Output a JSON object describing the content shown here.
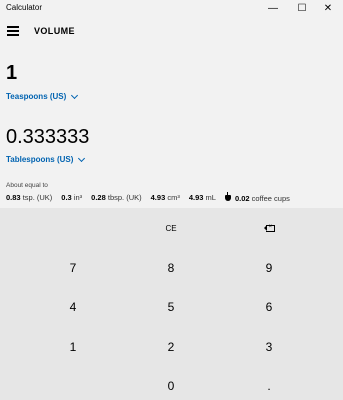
{
  "window": {
    "title": "Calculator",
    "minimize": "—",
    "maximize": "☐",
    "close": "✕"
  },
  "header": {
    "mode": "VOLUME"
  },
  "from": {
    "value": "1",
    "unit": "Teaspoons (US)"
  },
  "to": {
    "value": "0.333333",
    "unit": "Tablespoons (US)"
  },
  "about": {
    "label": "About equal to",
    "items": [
      {
        "value": "0.83",
        "unit": "tsp. (UK)"
      },
      {
        "value": "0.3",
        "unit": "in³"
      },
      {
        "value": "0.28",
        "unit": "tbsp. (UK)"
      },
      {
        "value": "4.93",
        "unit": "cm³"
      },
      {
        "value": "4.93",
        "unit": "mL"
      },
      {
        "value": "0.02",
        "unit": "coffee cups",
        "icon": "coffee-cup-icon"
      }
    ]
  },
  "keypad": {
    "ce": "CE",
    "backspace_icon": "backspace-icon",
    "k7": "7",
    "k8": "8",
    "k9": "9",
    "k4": "4",
    "k5": "5",
    "k6": "6",
    "k1": "1",
    "k2": "2",
    "k3": "3",
    "k0": "0",
    "decimal": "."
  }
}
